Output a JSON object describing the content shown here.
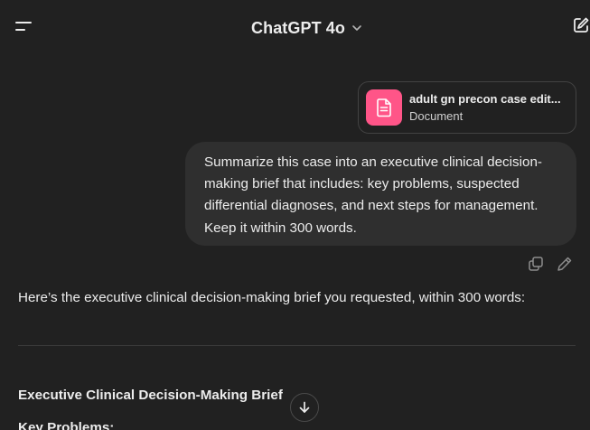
{
  "header": {
    "model_name": "ChatGPT 4o"
  },
  "attachment": {
    "file_name": "adult gn precon case edit...",
    "file_type": "Document"
  },
  "user_message": {
    "lines": [
      "Summarize this case into an executive clinical decision-",
      "making brief that includes: key problems, suspected",
      "differential diagnoses, and next steps for management.",
      "Keep it within 300 words."
    ]
  },
  "assistant_message": {
    "intro": "Here’s the executive clinical decision-making brief you requested, within 300 words:",
    "brief_title": "Executive Clinical Decision-Making Brief",
    "section_heading": "Key Problems:"
  },
  "colors": {
    "background": "#212121",
    "bubble": "#2f2f2f",
    "doc_icon": "#ff5588",
    "text": "#ececec"
  },
  "icons": {
    "menu": "menu-icon",
    "chevron": "chevron-down-icon",
    "new_chat": "edit-icon",
    "document": "document-icon",
    "copy": "copy-icon",
    "edit": "pencil-icon",
    "scroll": "arrow-down-icon"
  }
}
